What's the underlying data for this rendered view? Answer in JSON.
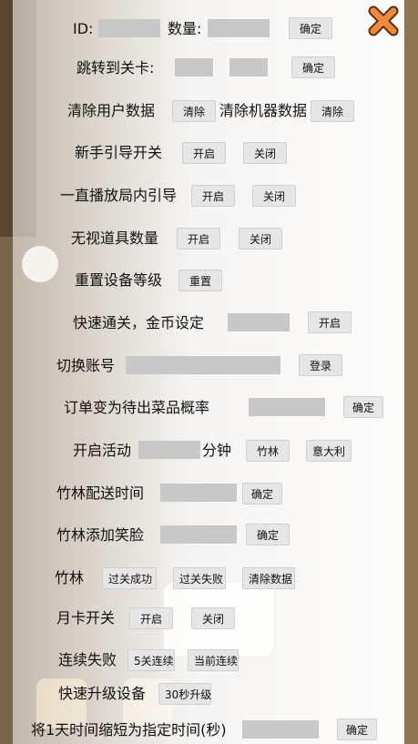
{
  "row1": {
    "id_label": "ID:",
    "qty_label": "数量:",
    "confirm": "确定"
  },
  "row2": {
    "label": "跳转到关卡:",
    "confirm": "确定"
  },
  "row3": {
    "label_user": "清除用户数据",
    "clear_user": "清除",
    "label_machine": "清除机器数据",
    "clear_machine": "清除"
  },
  "row4": {
    "label": "新手引导开关",
    "on": "开启",
    "off": "关闭"
  },
  "row5": {
    "label": "一直播放局内引导",
    "on": "开启",
    "off": "关闭"
  },
  "row6": {
    "label": "无视道具数量",
    "on": "开启",
    "off": "关闭"
  },
  "row7": {
    "label": "重置设备等级",
    "reset": "重置"
  },
  "row8": {
    "label": "快速通关，金币设定",
    "on": "开启"
  },
  "row9": {
    "label": "切换账号",
    "login": "登录"
  },
  "row10": {
    "label": "订单变为待出菜品概率",
    "confirm": "确定"
  },
  "row11": {
    "label": "开启活动",
    "unit": "分钟",
    "bamboo": "竹林",
    "italy": "意大利"
  },
  "row12": {
    "label": "竹林配送时间",
    "confirm": "确定"
  },
  "row13": {
    "label": "竹林添加笑脸",
    "confirm": "确定"
  },
  "row14": {
    "label": "竹林",
    "pass": "过关成功",
    "fail": "过关失败",
    "clear": "清除数据"
  },
  "row15": {
    "label": "月卡开关",
    "on": "开启",
    "off": "关闭"
  },
  "row16": {
    "label": "连续失败",
    "five": "5关连续",
    "current": "当前连续"
  },
  "row17": {
    "label": "快速升级设备",
    "upgrade": "30秒升级"
  },
  "row18": {
    "label": "将1天时间缩短为指定时间(秒)",
    "confirm": "确定"
  },
  "colors": {
    "close_bg": "#f08a3c",
    "box": "#c8c8c8",
    "button": "#e6e6e6"
  }
}
